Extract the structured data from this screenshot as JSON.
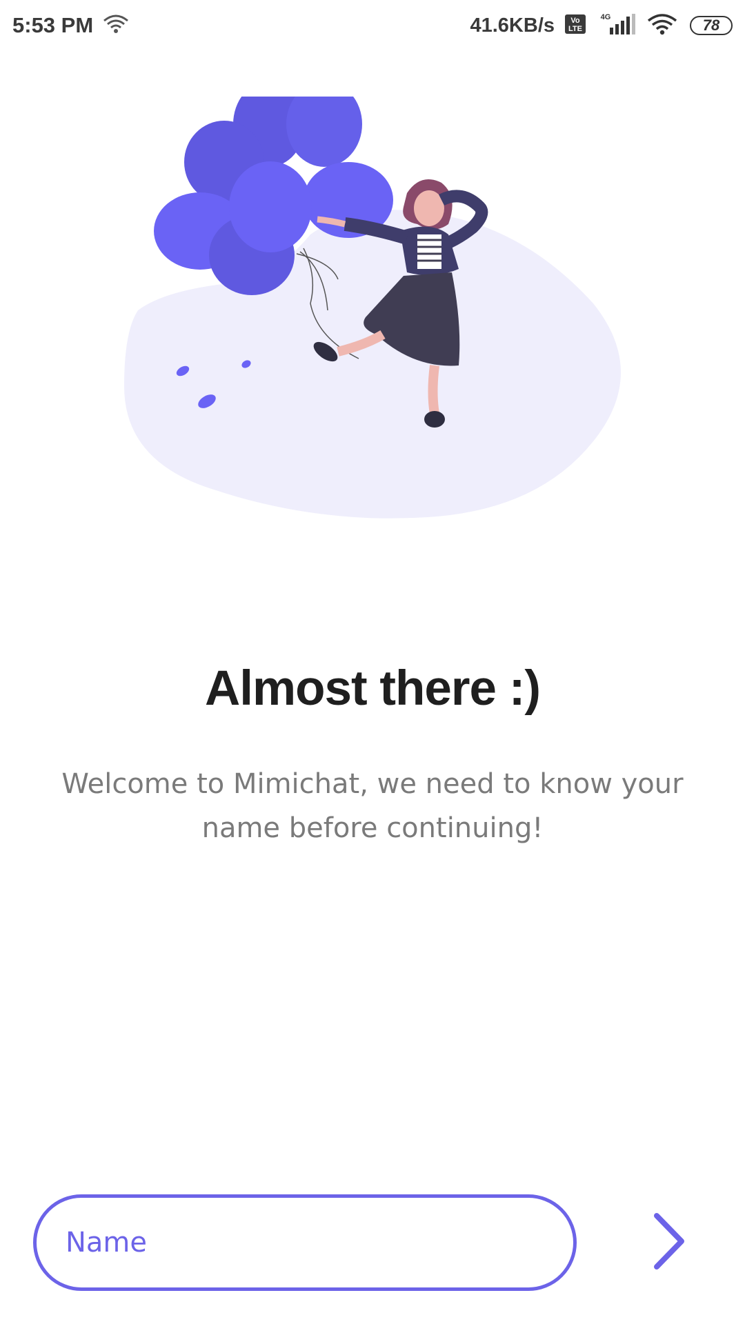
{
  "status_bar": {
    "time": "5:53 PM",
    "net_speed": "41.6KB/s",
    "volte": "Vo LTE",
    "network": "4G",
    "battery": "78"
  },
  "illustration": {
    "subject": "woman-with-balloons",
    "colors": {
      "balloons": "#6c63ff",
      "blob": "#efeefc",
      "skirt": "#403d53",
      "jacket": "#3f3d6b",
      "hair": "#8a4a6a",
      "skin": "#efb7b0"
    }
  },
  "onboarding": {
    "title": "Almost there  :)",
    "message": "Welcome to Mimichat, we need to know your name before continuing!"
  },
  "form": {
    "name_placeholder": "Name",
    "name_value": "",
    "next_icon": "chevron-right-icon"
  },
  "colors": {
    "accent": "#6c63e8",
    "title": "#1f1f1f",
    "body": "#7a7a7a"
  }
}
